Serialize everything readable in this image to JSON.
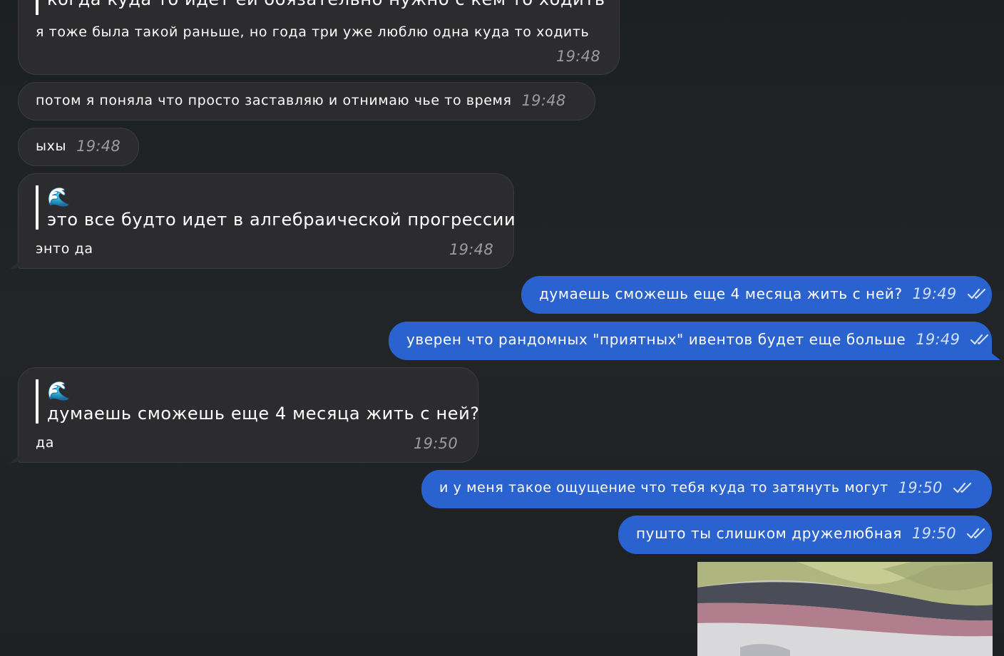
{
  "messages": {
    "m1": {
      "quote_text": "когда куда то идет ей обязательно нужно с кем то ходить",
      "text": "я тоже была такой раньше, но года три уже люблю одна куда то ходить",
      "time": "19:48"
    },
    "m2": {
      "text": "потом я поняла что просто заставляю и отнимаю чье то время",
      "time": "19:48"
    },
    "m3": {
      "text": "ыхы",
      "time": "19:48"
    },
    "m4": {
      "quote_emoji": "🌊",
      "quote_text": "это все будто идет в алгебраической прогрессии",
      "text": "энто да",
      "time": "19:48"
    },
    "m5": {
      "text": "думаешь сможешь еще 4 месяца жить с ней?",
      "time": "19:49"
    },
    "m6": {
      "text": "уверен что рандомных \"приятных\" ивентов будет еще больше",
      "time": "19:49"
    },
    "m7": {
      "quote_emoji": "🌊",
      "quote_text": "думаешь сможешь еще 4 месяца жить с ней?",
      "text": "да",
      "time": "19:50"
    },
    "m8": {
      "text": "и у меня такое ощущение что тебя куда то затянуть могут",
      "time": "19:50"
    },
    "m9": {
      "text": "пушто ты слишком дружелюбная",
      "time": "19:50"
    }
  },
  "colors": {
    "background": "#1f2224",
    "incoming_bubble": "#2c2c2e",
    "outgoing_bubble": "#2a62cf"
  },
  "icons": {
    "read_status": "double-check-icon"
  }
}
